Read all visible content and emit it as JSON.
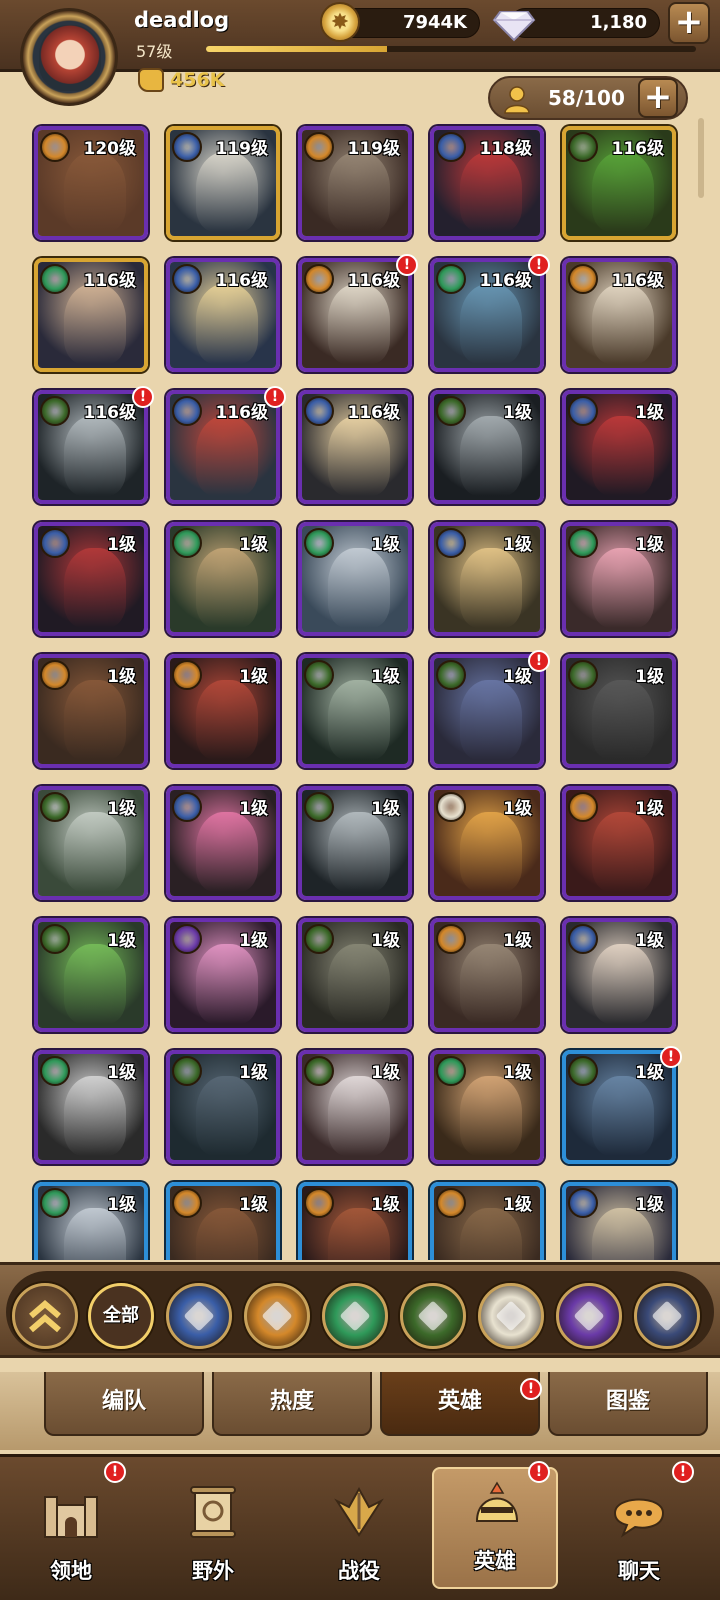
{
  "player": {
    "name": "deadlog",
    "level": "57级",
    "xp_progress": 0.37,
    "power": "456K"
  },
  "resources": {
    "gold": "7944K",
    "diamonds": "1,180"
  },
  "roster": {
    "count": "58/100"
  },
  "icons": {
    "gold": "coin-icon",
    "diamond": "diamond-icon",
    "power": "fist-icon",
    "roster": "person-icon",
    "add": "plus-icon",
    "collapse": "double-chevron-up-icon",
    "alert": "exclamation-icon"
  },
  "factions": [
    {
      "id": "all",
      "label": "全部",
      "color": "#4a3220"
    },
    {
      "id": "lightbearer",
      "color": "#3a5ea8"
    },
    {
      "id": "mauler",
      "color": "#d4882a"
    },
    {
      "id": "wilder",
      "color": "#2f9a5a"
    },
    {
      "id": "graveborn",
      "color": "#3c6a2a"
    },
    {
      "id": "celestial",
      "color": "#e8e2d0"
    },
    {
      "id": "hypogean",
      "color": "#6a3aa8"
    },
    {
      "id": "dimensional",
      "color": "#3a4a78"
    }
  ],
  "heroes": [
    {
      "level": "120级",
      "frame": "purple",
      "faction": "mauler",
      "palette": [
        "#5b3a28",
        "#8a5a3a"
      ],
      "alert": false
    },
    {
      "level": "119级",
      "frame": "gold",
      "faction": "lightbearer",
      "palette": [
        "#2a3440",
        "#e0dcd0"
      ],
      "alert": false
    },
    {
      "level": "119级",
      "frame": "purple",
      "faction": "mauler",
      "palette": [
        "#3a2a24",
        "#9a8a78"
      ],
      "alert": false
    },
    {
      "level": "118级",
      "frame": "purple",
      "faction": "lightbearer",
      "palette": [
        "#24202e",
        "#c23a3a"
      ],
      "alert": false
    },
    {
      "level": "116级",
      "frame": "gold",
      "faction": "graveborn",
      "palette": [
        "#2a3a1a",
        "#5aa83a"
      ],
      "alert": false
    },
    {
      "level": "116级",
      "frame": "gold",
      "faction": "wilder",
      "palette": [
        "#2a2a3a",
        "#d8b898"
      ],
      "alert": false
    },
    {
      "level": "116级",
      "frame": "purple",
      "faction": "lightbearer",
      "palette": [
        "#28344a",
        "#f0d89a"
      ],
      "alert": false
    },
    {
      "level": "116级",
      "frame": "purple",
      "faction": "mauler",
      "palette": [
        "#3a2a24",
        "#e8e0d0"
      ],
      "alert": true
    },
    {
      "level": "116级",
      "frame": "purple",
      "faction": "wilder",
      "palette": [
        "#2a3440",
        "#6a9ab8"
      ],
      "alert": true
    },
    {
      "level": "116级",
      "frame": "purple",
      "faction": "mauler",
      "palette": [
        "#4a3a2a",
        "#e8dcc8"
      ],
      "alert": false
    },
    {
      "level": "116级",
      "frame": "purple",
      "faction": "graveborn",
      "palette": [
        "#1e2428",
        "#b8c0c4"
      ],
      "alert": true
    },
    {
      "level": "116级",
      "frame": "purple",
      "faction": "lightbearer",
      "palette": [
        "#2a3440",
        "#c8483a"
      ],
      "alert": true
    },
    {
      "level": "116级",
      "frame": "purple",
      "faction": "lightbearer",
      "palette": [
        "#2a2a2e",
        "#f0d8a8"
      ],
      "alert": false
    },
    {
      "level": "1级",
      "frame": "purple",
      "faction": "graveborn",
      "palette": [
        "#1a1e22",
        "#a8b0b4"
      ],
      "alert": false
    },
    {
      "level": "1级",
      "frame": "purple",
      "faction": "lightbearer",
      "palette": [
        "#201a24",
        "#c23a3a"
      ],
      "alert": false
    },
    {
      "level": "1级",
      "frame": "purple",
      "faction": "lightbearer",
      "palette": [
        "#201a24",
        "#b83a3a"
      ],
      "alert": false
    },
    {
      "level": "1级",
      "frame": "purple",
      "faction": "wilder",
      "palette": [
        "#2a3a2a",
        "#c8a878"
      ],
      "alert": false
    },
    {
      "level": "1级",
      "frame": "purple",
      "faction": "wilder",
      "palette": [
        "#3a4a5a",
        "#c8d0d8"
      ],
      "alert": false
    },
    {
      "level": "1级",
      "frame": "purple",
      "faction": "lightbearer",
      "palette": [
        "#3a3424",
        "#e8c88a"
      ],
      "alert": false
    },
    {
      "level": "1级",
      "frame": "purple",
      "faction": "wilder",
      "palette": [
        "#3a2a2a",
        "#f0a8b8"
      ],
      "alert": false
    },
    {
      "level": "1级",
      "frame": "purple",
      "faction": "mauler",
      "palette": [
        "#3a2a20",
        "#8a5a3a"
      ],
      "alert": false
    },
    {
      "level": "1级",
      "frame": "purple",
      "faction": "mauler",
      "palette": [
        "#2a1a1a",
        "#b84a3a"
      ],
      "alert": false
    },
    {
      "level": "1级",
      "frame": "purple",
      "faction": "graveborn",
      "palette": [
        "#1e2a24",
        "#a8b8a8"
      ],
      "alert": false
    },
    {
      "level": "1级",
      "frame": "purple",
      "faction": "graveborn",
      "palette": [
        "#2a2a3a",
        "#6a78a8"
      ],
      "alert": true
    },
    {
      "level": "1级",
      "frame": "purple",
      "faction": "graveborn",
      "palette": [
        "#2a2a2a",
        "#5a5a5a"
      ],
      "alert": false
    },
    {
      "level": "1级",
      "frame": "purple",
      "faction": "graveborn",
      "palette": [
        "#3a4a3a",
        "#c8d0c8"
      ],
      "alert": false
    },
    {
      "level": "1级",
      "frame": "purple",
      "faction": "lightbearer",
      "palette": [
        "#2a2024",
        "#e878a8"
      ],
      "alert": false
    },
    {
      "level": "1级",
      "frame": "purple",
      "faction": "graveborn",
      "palette": [
        "#1e2428",
        "#b8c0c4"
      ],
      "alert": false
    },
    {
      "level": "1级",
      "frame": "purple",
      "faction": "celestial",
      "palette": [
        "#4a2a1a",
        "#e8a84a"
      ],
      "alert": false
    },
    {
      "level": "1级",
      "frame": "purple",
      "faction": "mauler",
      "palette": [
        "#3a1a1a",
        "#b84a3a"
      ],
      "alert": false
    },
    {
      "level": "1级",
      "frame": "purple",
      "faction": "graveborn",
      "palette": [
        "#2a3a2a",
        "#78c05a"
      ],
      "alert": false
    },
    {
      "level": "1级",
      "frame": "purple",
      "faction": "hypogean",
      "palette": [
        "#2a1a2a",
        "#e898c8"
      ],
      "alert": false
    },
    {
      "level": "1级",
      "frame": "purple",
      "faction": "graveborn",
      "palette": [
        "#2a2a24",
        "#8a8a78"
      ],
      "alert": false
    },
    {
      "level": "1级",
      "frame": "purple",
      "faction": "mauler",
      "palette": [
        "#3a2a24",
        "#9a8a78"
      ],
      "alert": false
    },
    {
      "level": "1级",
      "frame": "purple",
      "faction": "lightbearer",
      "palette": [
        "#2a2a2e",
        "#e8d8c8"
      ],
      "alert": false
    },
    {
      "level": "1级",
      "frame": "purple",
      "faction": "wilder",
      "palette": [
        "#2a2a2a",
        "#d8d8d8"
      ],
      "alert": false
    },
    {
      "level": "1级",
      "frame": "purple",
      "faction": "graveborn",
      "palette": [
        "#1e2a30",
        "#5a6a78"
      ],
      "alert": false
    },
    {
      "level": "1级",
      "frame": "purple",
      "faction": "graveborn",
      "palette": [
        "#3a2a2a",
        "#e8e0e0"
      ],
      "alert": false
    },
    {
      "level": "1级",
      "frame": "purple",
      "faction": "wilder",
      "palette": [
        "#3a2a1a",
        "#d8a878"
      ],
      "alert": false
    },
    {
      "level": "1级",
      "frame": "blue",
      "faction": "graveborn",
      "palette": [
        "#1e2a3a",
        "#6a88a8"
      ],
      "alert": true
    },
    {
      "level": "1级",
      "frame": "blue",
      "faction": "wilder",
      "palette": [
        "#2a3440",
        "#c8d0d8"
      ],
      "alert": false
    },
    {
      "level": "1级",
      "frame": "blue",
      "faction": "mauler",
      "palette": [
        "#3a2a20",
        "#8a5a3a"
      ],
      "alert": false
    },
    {
      "level": "1级",
      "frame": "blue",
      "faction": "mauler",
      "palette": [
        "#2a1a1a",
        "#a85a3a"
      ],
      "alert": false
    },
    {
      "level": "1级",
      "frame": "blue",
      "faction": "mauler",
      "palette": [
        "#3a2a20",
        "#8a6a4a"
      ],
      "alert": false
    },
    {
      "level": "1级",
      "frame": "blue",
      "faction": "lightbearer",
      "palette": [
        "#2a2a3a",
        "#d8c8a8"
      ],
      "alert": false
    }
  ],
  "subtabs": [
    {
      "label": "编队",
      "active": false,
      "alert": false
    },
    {
      "label": "热度",
      "active": false,
      "alert": false
    },
    {
      "label": "英雄",
      "active": true,
      "alert": true
    },
    {
      "label": "图鉴",
      "active": false,
      "alert": false
    }
  ],
  "nav": [
    {
      "label": "领地",
      "icon": "castle-icon",
      "active": false,
      "alert": true
    },
    {
      "label": "野外",
      "icon": "scroll-map-icon",
      "active": false,
      "alert": false
    },
    {
      "label": "战役",
      "icon": "crossed-swords-icon",
      "active": false,
      "alert": false
    },
    {
      "label": "英雄",
      "icon": "helmet-icon",
      "active": true,
      "alert": true
    },
    {
      "label": "聊天",
      "icon": "chat-bubble-icon",
      "active": false,
      "alert": true
    }
  ]
}
